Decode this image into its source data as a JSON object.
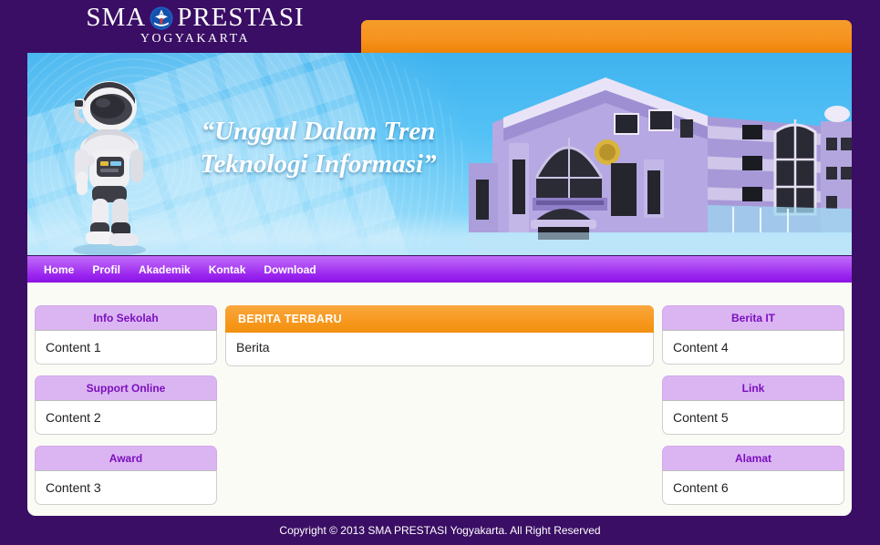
{
  "header": {
    "brand_title_left": "SMA",
    "brand_title_right": "PRESTASI",
    "brand_subtitle": "YOGYAKARTA",
    "emblem_icon": "tut-wuri-handayani-emblem"
  },
  "banner": {
    "slogan_line1": "“Unggul Dalam Tren",
    "slogan_line2": "Teknologi Informasi”",
    "robot_icon": "humanoid-robot-illustration",
    "building_icon": "school-building-illustration"
  },
  "nav": {
    "items": [
      {
        "label": "Home"
      },
      {
        "label": "Profil"
      },
      {
        "label": "Akademik"
      },
      {
        "label": "Kontak"
      },
      {
        "label": "Download"
      }
    ]
  },
  "sidebar_left": {
    "widgets": [
      {
        "title": "Info Sekolah",
        "content": "Content 1"
      },
      {
        "title": "Support Online",
        "content": "Content 2"
      },
      {
        "title": "Award",
        "content": "Content 3"
      }
    ]
  },
  "sidebar_right": {
    "widgets": [
      {
        "title": "Berita IT",
        "content": "Content 4"
      },
      {
        "title": "Link",
        "content": "Content 5"
      },
      {
        "title": "Alamat",
        "content": "Content 6"
      }
    ]
  },
  "main_panel": {
    "title": "BERITA TERBARU",
    "content": "Berita"
  },
  "footer": {
    "copyright": "Copyright © 2013 SMA PRESTASI Yogyakarta. All Right Reserved"
  },
  "colors": {
    "page_background": "#3a0e64",
    "nav_gradient_top": "#c06bf8",
    "nav_gradient_bottom": "#8a13e4",
    "accent_orange": "#f7981d",
    "widget_header": "#dbb5f2",
    "widget_header_text": "#7a0fbe",
    "content_background": "#fbfbf5",
    "banner_blue": "#53c1f5"
  }
}
